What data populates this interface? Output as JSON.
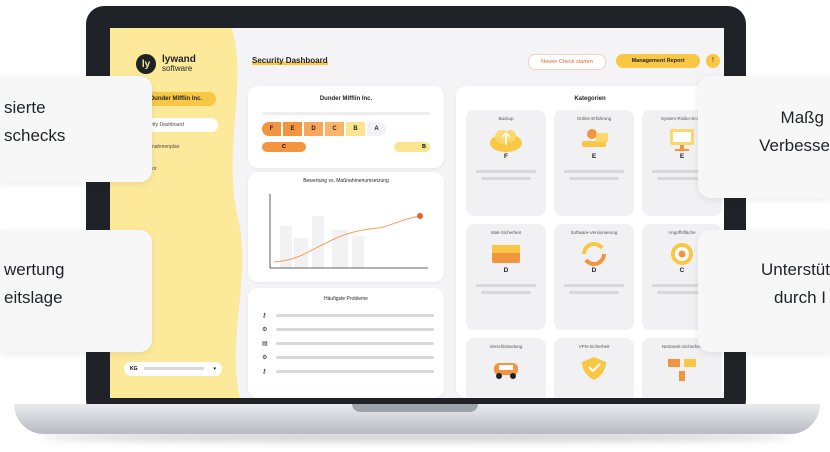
{
  "sidebar": {
    "logo_name": "lywand",
    "logo_sub": "software",
    "company": "Dunder Mifflin Inc.",
    "nav": [
      "Security Dashboard",
      "Massnahmenplan",
      "Monitor"
    ],
    "user_initials": "KG"
  },
  "header": {
    "title": "Security Dashboard",
    "new_check": "Neuen Check starten",
    "report": "Management Report",
    "help_icon": "!",
    "user_icon": "•"
  },
  "grade_card": {
    "company": "Dunder Mifflin Inc.",
    "grades": [
      "F",
      "E",
      "D",
      "C",
      "B",
      "A"
    ],
    "current_grade": "C",
    "target_grade": "B"
  },
  "chart_card": {
    "title": "Bewertung vs. Maßnahmenumsetzung"
  },
  "problems_card": {
    "title": "Häufigste Probleme"
  },
  "categories_card": {
    "title": "Kategorien",
    "tiles": [
      {
        "name": "Backup",
        "grade": "F"
      },
      {
        "name": "Online-Erfahrung",
        "grade": "E"
      },
      {
        "name": "System-Risiko-Score",
        "grade": "E"
      },
      {
        "name": "Mail-Sicherheit",
        "grade": "D"
      },
      {
        "name": "Software-Versionierung",
        "grade": "D"
      },
      {
        "name": "Angriffsfläche",
        "grade": "C"
      },
      {
        "name": "Verschlüsselung",
        "grade": ""
      },
      {
        "name": "VPN-Sicherheit",
        "grade": ""
      },
      {
        "name": "Netzwerk-Sicherheit",
        "grade": ""
      }
    ]
  },
  "callouts": {
    "left_top": [
      "sierte",
      "schecks"
    ],
    "left_bottom": [
      "wertung",
      "eitslage"
    ],
    "right_top": [
      "Maßg",
      "Verbesse"
    ],
    "right_bottom": [
      "Unterstüt",
      "durch I"
    ]
  }
}
